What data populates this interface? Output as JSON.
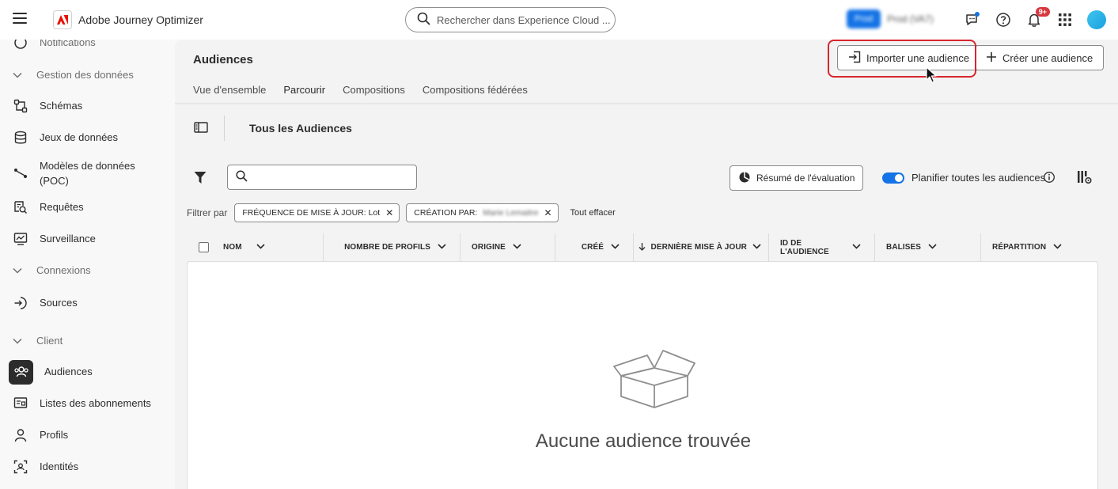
{
  "app": {
    "title": "Adobe Journey Optimizer",
    "logo_letter": "A"
  },
  "search": {
    "placeholder": "Rechercher dans Experience Cloud ..."
  },
  "environment": {
    "badge": "Prod",
    "label": "Prod (VA7)"
  },
  "notifications": {
    "count": "9+"
  },
  "sidebar": {
    "partial_top": "Notifications",
    "items": [
      {
        "type": "heading",
        "label": "Gestion des données"
      },
      {
        "type": "item",
        "label": "Schémas",
        "icon": "schema-icon"
      },
      {
        "type": "item",
        "label": "Jeux de données",
        "icon": "database-icon"
      },
      {
        "type": "item",
        "label": "Modèles de données (POC)",
        "icon": "data-model-icon"
      },
      {
        "type": "item",
        "label": "Requêtes",
        "icon": "query-icon"
      },
      {
        "type": "item",
        "label": "Surveillance",
        "icon": "monitoring-icon"
      },
      {
        "type": "heading",
        "label": "Connexions"
      },
      {
        "type": "item",
        "label": "Sources",
        "icon": "sources-icon"
      },
      {
        "type": "heading",
        "label": "Client"
      },
      {
        "type": "item",
        "label": "Audiences",
        "icon": "audiences-icon",
        "active": true
      },
      {
        "type": "item",
        "label": "Listes des abonnements",
        "icon": "subscription-icon"
      },
      {
        "type": "item",
        "label": "Profils",
        "icon": "profile-icon"
      },
      {
        "type": "item",
        "label": "Identités",
        "icon": "identity-icon"
      }
    ]
  },
  "page": {
    "title": "Audiences",
    "import_button": "Importer une audience",
    "create_button": "Créer une audience",
    "tabs": [
      {
        "label": "Vue d'ensemble",
        "active": false
      },
      {
        "label": "Parcourir",
        "active": true
      },
      {
        "label": "Compositions",
        "active": false
      },
      {
        "label": "Compositions fédérées",
        "active": false
      }
    ],
    "panel_title": "Tous les Audiences",
    "evaluation_button": "Résumé de l'évaluation",
    "schedule_toggle_label": "Planifier toutes les audiences",
    "schedule_toggle_on": true,
    "filter_by": "Filtrer par",
    "filter_chips": [
      {
        "label": "FRÉQUENCE DE MISE À JOUR: Lot",
        "value": ""
      },
      {
        "label": "CRÉATION PAR:",
        "value": "Marie Lemaitre"
      }
    ],
    "clear_all": "Tout effacer",
    "columns": [
      "NOM",
      "NOMBRE DE PROFILS",
      "ORIGINE",
      "CRÉÉ",
      "DERNIÈRE MISE À JOUR",
      "ID DE L'AUDIENCE",
      "BALISES",
      "RÉPARTITION"
    ],
    "empty_message": "Aucune audience trouvée"
  },
  "colors": {
    "accent": "#1473e6",
    "highlight": "#d7262e",
    "badge": "#d7373f"
  }
}
